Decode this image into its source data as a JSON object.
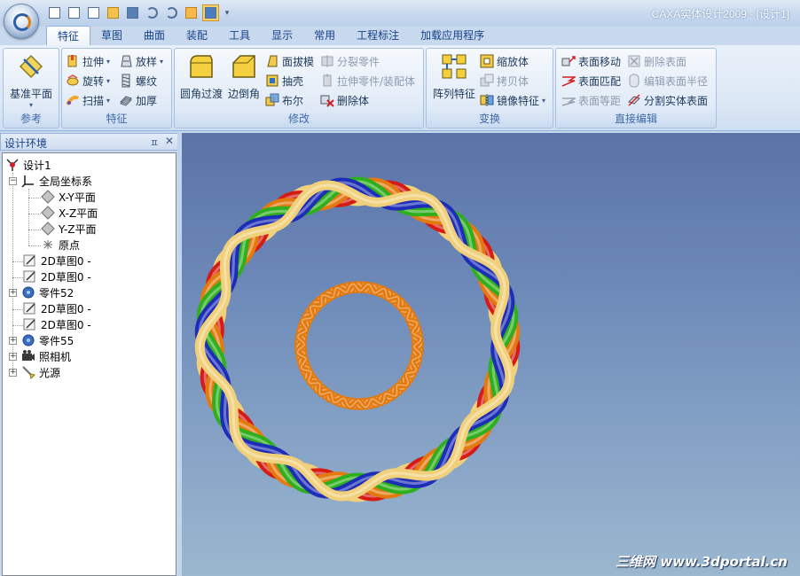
{
  "window": {
    "title": "CAXA实体设计2009 - [设计1]"
  },
  "quick_access": [
    "new-icon",
    "close-doc-icon",
    "open-icon",
    "folder-icon",
    "save-icon",
    "undo-icon",
    "redo-icon",
    "highlight-icon",
    "select-tool-icon",
    "dropdown-icon"
  ],
  "tabs": [
    {
      "label": "特征",
      "active": true
    },
    {
      "label": "草图"
    },
    {
      "label": "曲面"
    },
    {
      "label": "装配"
    },
    {
      "label": "工具"
    },
    {
      "label": "显示"
    },
    {
      "label": "常用"
    },
    {
      "label": "工程标注"
    },
    {
      "label": "加载应用程序"
    }
  ],
  "ribbon": {
    "groups": {
      "reference": {
        "title": "参考",
        "plane": "基准平面"
      },
      "feature": {
        "title": "特征",
        "extrude": "拉伸",
        "revolve": "旋转",
        "sweep": "扫描",
        "loft": "放样",
        "thread": "螺纹",
        "thicken": "加厚"
      },
      "modify": {
        "title": "修改",
        "fillet": "圆角过渡",
        "chamfer": "边倒角",
        "draft": "面拔模",
        "shell": "抽壳",
        "boolean": "布尔",
        "split_part": "分裂零件",
        "stretch": "拉伸零件/装配体",
        "delete_body": "删除体"
      },
      "transform": {
        "title": "变换",
        "pattern": "阵列特征",
        "scale": "缩放体",
        "copy": "拷贝体",
        "mirror": "镜像特征"
      },
      "direct_edit": {
        "title": "直接编辑",
        "move_face": "表面移动",
        "match_face": "表面匹配",
        "offset_face": "表面等距",
        "delete_face": "删除表面",
        "edit_radius": "编辑表面半径",
        "split_solid": "分割实体表面"
      }
    }
  },
  "panel": {
    "title": "设计环境",
    "pin": "ㅍ",
    "close": "✕"
  },
  "tree": {
    "root": "设计1",
    "coord": "全局坐标系",
    "xy": "X-Y平面",
    "xz": "X-Z平面",
    "yz": "Y-Z平面",
    "origin": "原点",
    "sketch1": "2D草图0 -",
    "sketch2": "2D草图0 -",
    "part52": "零件52",
    "sketch3": "2D草图0 -",
    "sketch4": "2D草图0 -",
    "part55": "零件55",
    "camera": "照相机",
    "light": "光源"
  },
  "viewport": {
    "watermark": "三维网 www.3dportal.cn",
    "colors": {
      "red": "#d51b14",
      "orange": "#e37a10",
      "yellow": "#f0d07a",
      "green": "#2faf1d",
      "blue": "#1d2db8"
    }
  }
}
